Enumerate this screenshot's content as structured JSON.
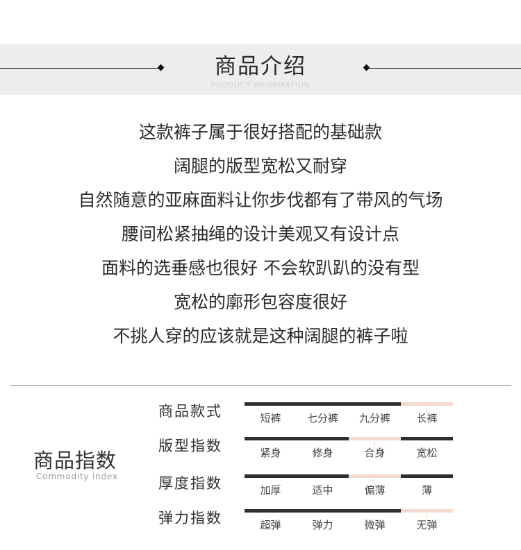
{
  "header": {
    "title": "商品介绍",
    "subtitle": "PRODUCT WFORMATION"
  },
  "description": [
    "这款裤子属于很好搭配的基础款",
    "阔腿的版型宽松又耐穿",
    "自然随意的亚麻面料让你步伐都有了带风的气场",
    "腰间松紧抽绳的设计美观又有设计点",
    "面料的选垂感也很好  不会软趴趴的没有型",
    "宽松的廓形包容度很好",
    "不挑人穿的应该就是这种阔腿的裤子啦"
  ],
  "index": {
    "title": "商品指数",
    "subtitle": "Commodity index",
    "colors": {
      "bar": "#2e2e2e",
      "selected": "#f3d9ce"
    },
    "rows": [
      {
        "label": "商品款式",
        "options": [
          "短裤",
          "七分裤",
          "九分裤",
          "长裤"
        ],
        "selected": 3
      },
      {
        "label": "版型指数",
        "options": [
          "紧身",
          "修身",
          "合身",
          "宽松"
        ],
        "selected": 2
      },
      {
        "label": "厚度指数",
        "options": [
          "加厚",
          "适中",
          "偏薄",
          "薄"
        ],
        "selected": 2
      },
      {
        "label": "弹力指数",
        "options": [
          "超弹",
          "弹力",
          "微弹",
          "无弹"
        ],
        "selected": 3
      }
    ]
  }
}
